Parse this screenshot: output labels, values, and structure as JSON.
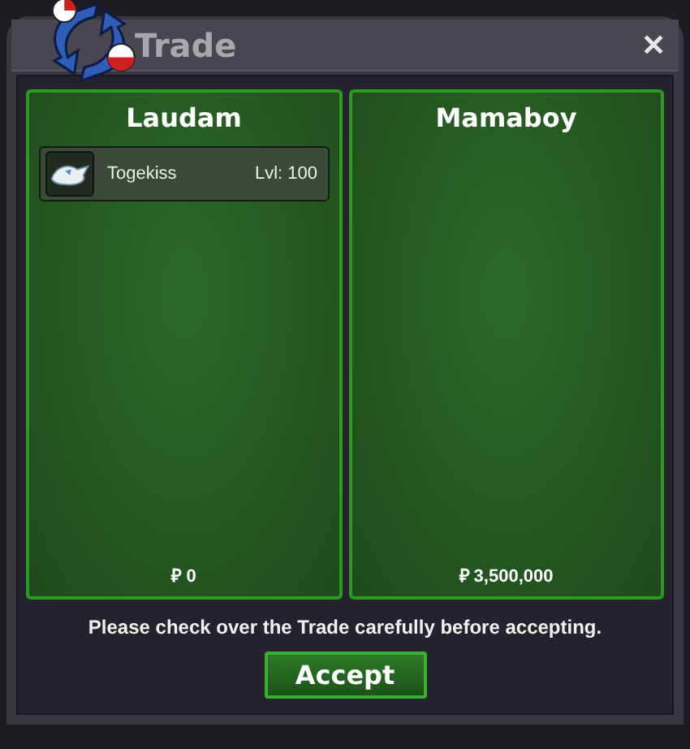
{
  "window": {
    "title": "Trade",
    "close": "✕"
  },
  "panels": [
    {
      "name": "Laudam",
      "items": [
        {
          "name": "Togekiss",
          "level": "Lvl: 100"
        }
      ],
      "money": "₽ 0"
    },
    {
      "name": "Mamaboy",
      "money": "₽ 3,500,000"
    }
  ],
  "message": "Please check over the Trade carefully before accepting.",
  "button": "Accept"
}
